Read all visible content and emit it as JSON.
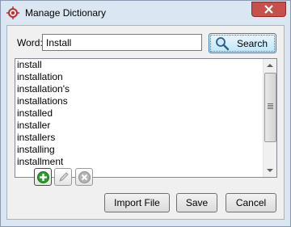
{
  "window": {
    "title": "Manage Dictionary"
  },
  "search": {
    "label": "Word:",
    "value": "Install",
    "button_label": "Search"
  },
  "list": {
    "items": [
      "install",
      "installation",
      "installation's",
      "installations",
      "installed",
      "installer",
      "installers",
      "installing",
      "installment"
    ]
  },
  "actions": {
    "import_label": "Import File",
    "save_label": "Save",
    "cancel_label": "Cancel"
  },
  "icons": {
    "add": "add-icon",
    "edit": "pencil-icon",
    "delete": "delete-icon"
  },
  "colors": {
    "close": "#c7504b",
    "add": "#2e9b2e",
    "accent": "#3c7fb1"
  }
}
